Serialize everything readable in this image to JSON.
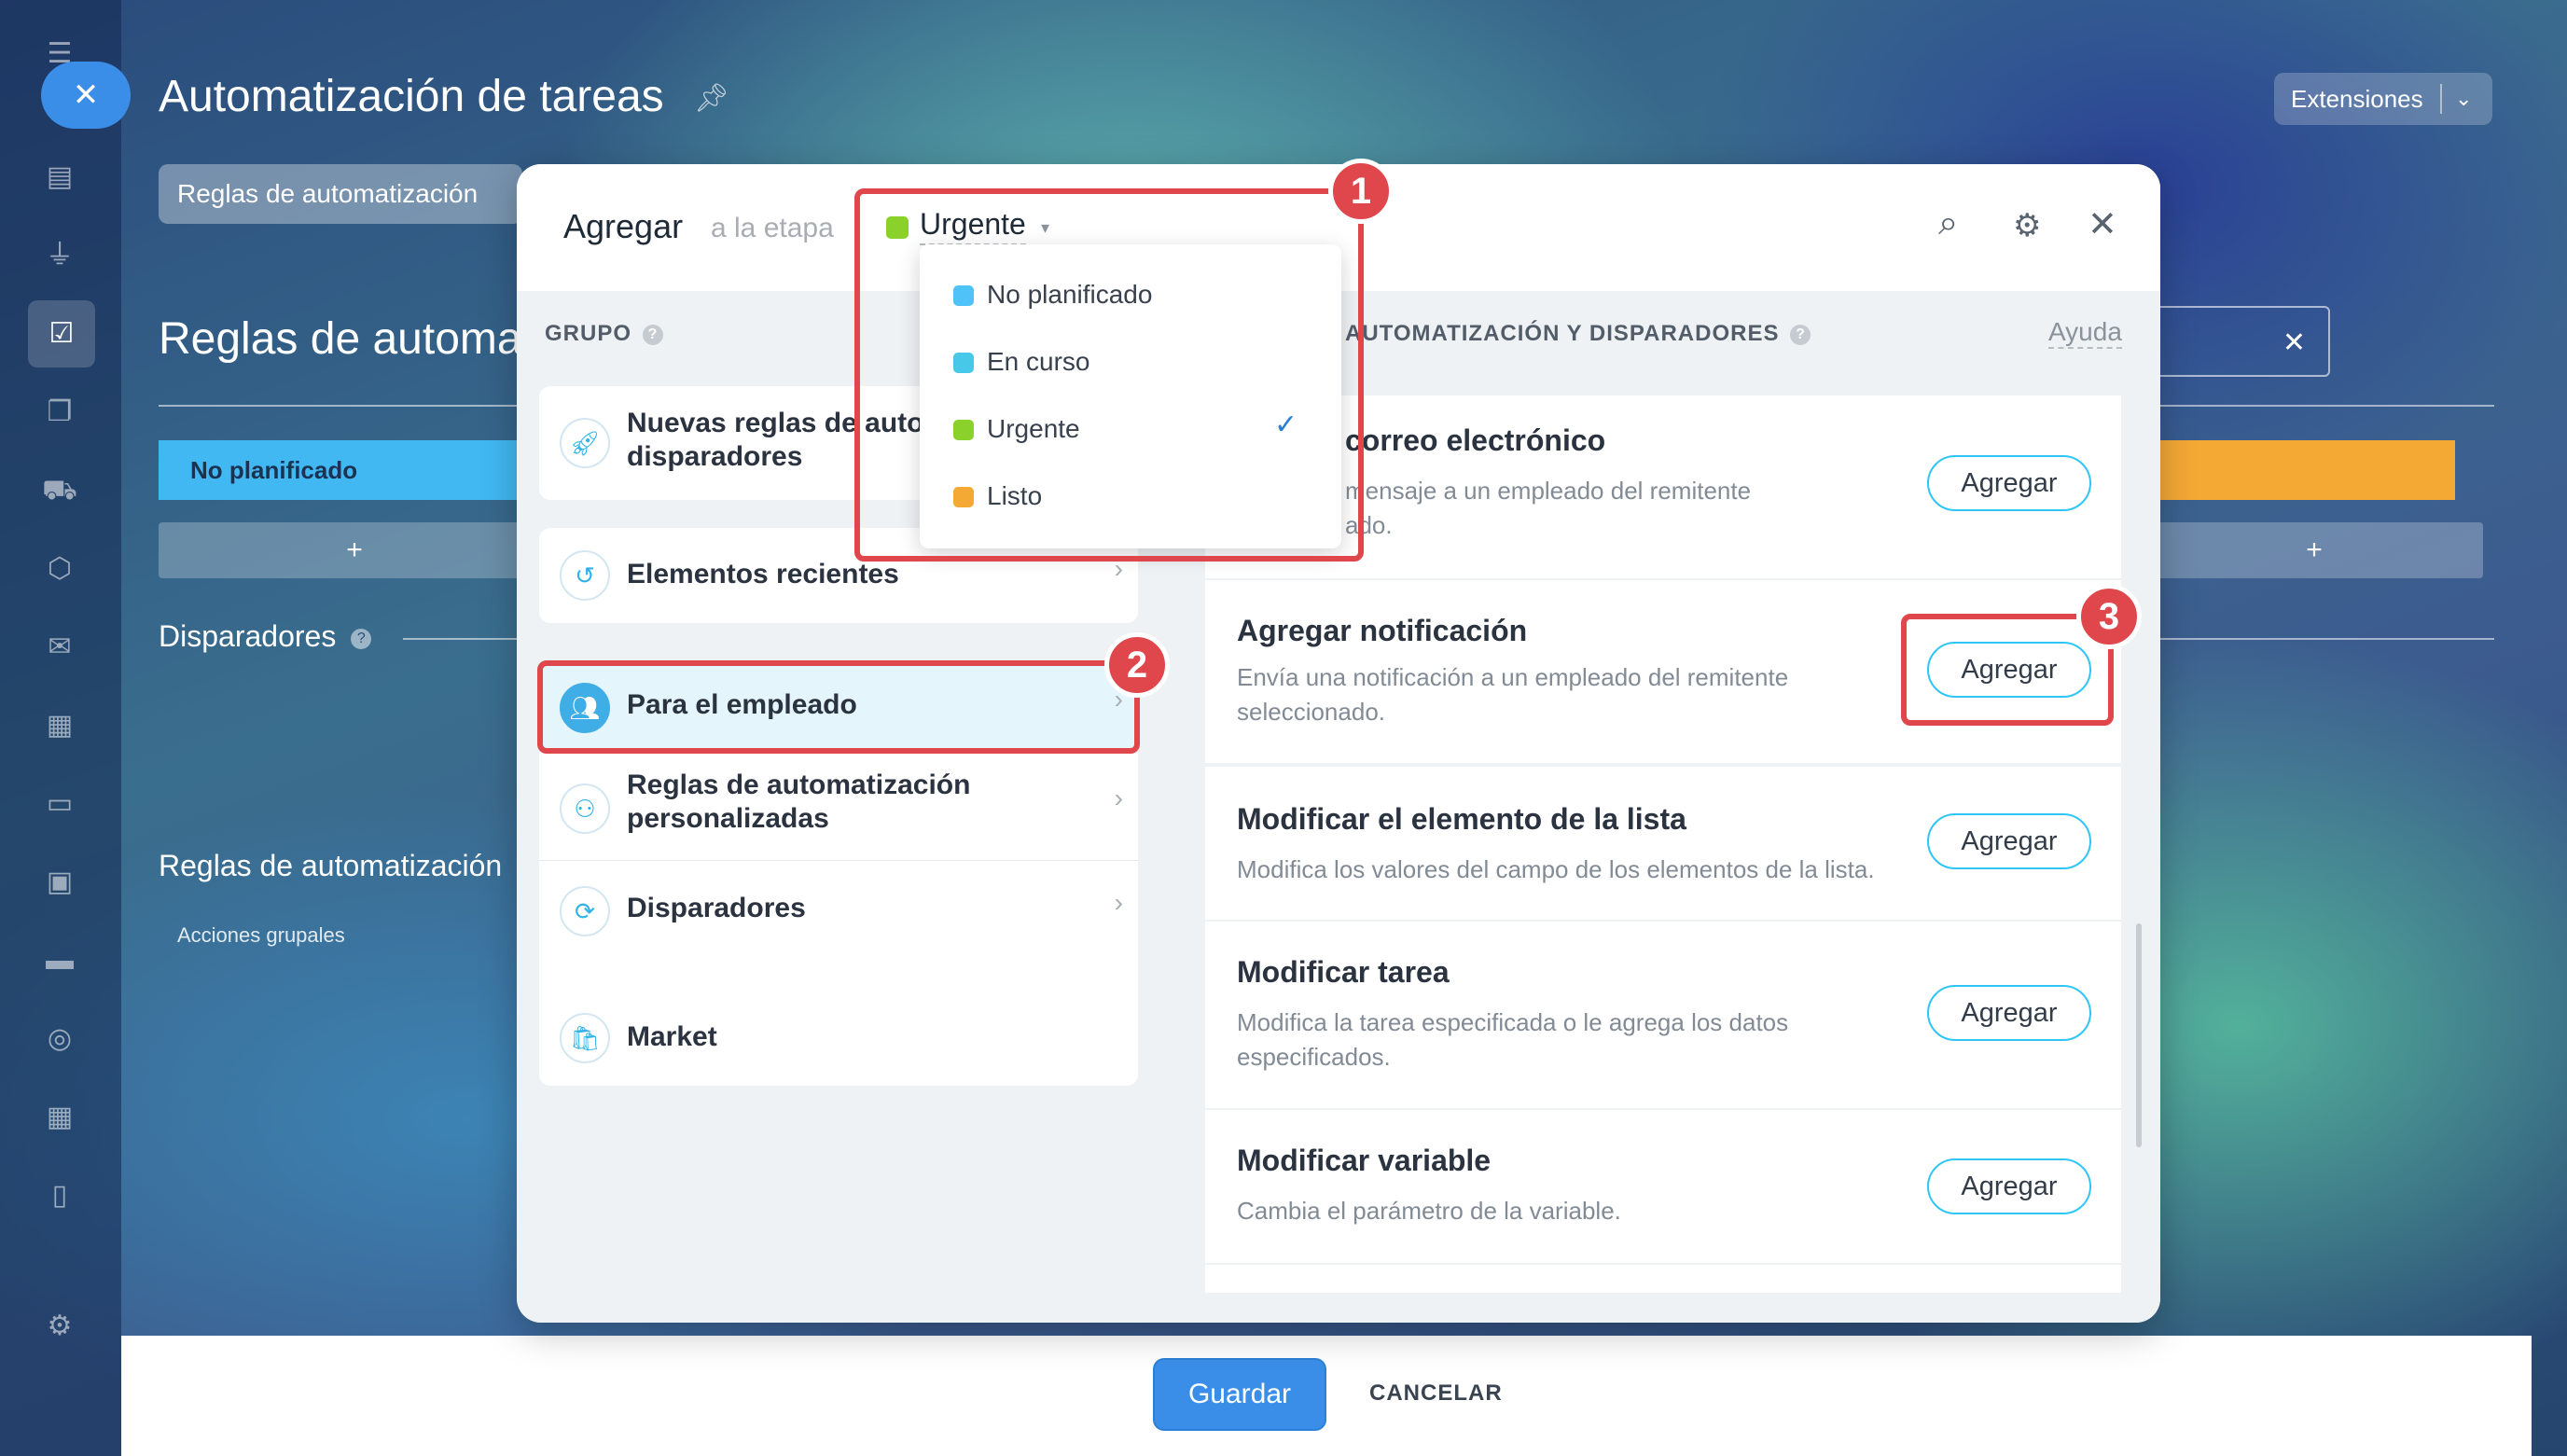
{
  "window": {
    "title": "Automatización de tareas",
    "extensions_label": "Extensiones",
    "tab_rules": "Reglas de automatización",
    "zoom_hint": "92%"
  },
  "background": {
    "heading": "Reglas de automa",
    "stage_not_planned": "No planificado",
    "plus": "+",
    "triggers_label": "Disparadores",
    "rules_label": "Reglas de automatización",
    "group_actions": "Acciones grupales",
    "search_close": "✕"
  },
  "modal": {
    "add_label": "Agregar",
    "stage_label": "a la etapa",
    "selected_stage": "Urgente",
    "group_title": "GRUPO",
    "actions_title": "AUTOMATIZACIÓN Y DISPARADORES",
    "help": "Ayuda",
    "groups": [
      {
        "label": "Nuevas reglas de automatización y disparadores",
        "line1": "Nuevas reglas de auto",
        "line2": "disparadores"
      },
      {
        "label": "Elementos recientes"
      },
      {
        "label": "Para el empleado"
      },
      {
        "label": "Reglas de automatización personalizadas",
        "line1": "Reglas de automatización",
        "line2": "personalizadas"
      },
      {
        "label": "Disparadores"
      },
      {
        "label": "Market"
      }
    ],
    "actions": [
      {
        "title": "correo electrónico",
        "desc": "mensaje a un empleado del remitente",
        "desc2": "ado.",
        "button": "Agregar"
      },
      {
        "title": "Agregar notificación",
        "desc": "Envía una notificación a un empleado del remitente seleccionado.",
        "button": "Agregar"
      },
      {
        "title": "Modificar el elemento de la lista",
        "desc": "Modifica los valores del campo de los elementos de la lista.",
        "button": "Agregar"
      },
      {
        "title": "Modificar tarea",
        "desc": "Modifica la tarea especificada o le agrega los datos especificados.",
        "button": "Agregar"
      },
      {
        "title": "Modificar variable",
        "desc": "Cambia el parámetro de la variable.",
        "button": "Agregar"
      }
    ]
  },
  "stage_dropdown": {
    "options": [
      {
        "label": "No planificado",
        "color": "#4fc3f7"
      },
      {
        "label": "En curso",
        "color": "#47c8e8"
      },
      {
        "label": "Urgente",
        "color": "#8bd12b",
        "selected": true
      },
      {
        "label": "Listo",
        "color": "#f5a935"
      }
    ]
  },
  "annotations": {
    "badge1": "1",
    "badge2": "2",
    "badge3": "3"
  },
  "footer": {
    "save": "Guardar",
    "cancel": "CANCELAR"
  },
  "colors": {
    "accent": "#3b8ee8",
    "highlight": "#e0474c",
    "button_border": "#2fc6f6"
  }
}
